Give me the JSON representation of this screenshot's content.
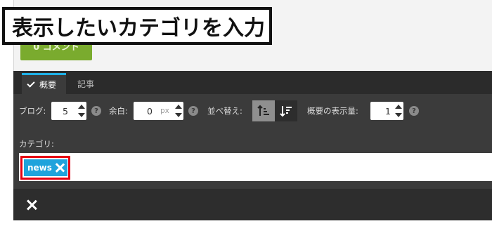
{
  "overlay": {
    "title": "表示したいカテゴリを入力"
  },
  "background": {
    "green_button_label": "0 コメント"
  },
  "tabs": [
    {
      "label": "概要",
      "active": true
    },
    {
      "label": "記事",
      "active": false
    }
  ],
  "settings": {
    "blog_label": "ブログ:",
    "blog_value": "5",
    "margin_label": "余白:",
    "margin_value": "0",
    "margin_unit": "px",
    "sort_label": "並べ替え:",
    "summary_count_label": "概要の表示量:",
    "summary_count_value": "1"
  },
  "category": {
    "label": "カテゴリ:",
    "tags": [
      {
        "label": "news"
      }
    ]
  },
  "colors": {
    "accent": "#1fb0e6",
    "tag": "#1fa3dc",
    "highlight": "#e60012",
    "green_button": "#7aab2e",
    "panel": "#3b3b3b"
  }
}
